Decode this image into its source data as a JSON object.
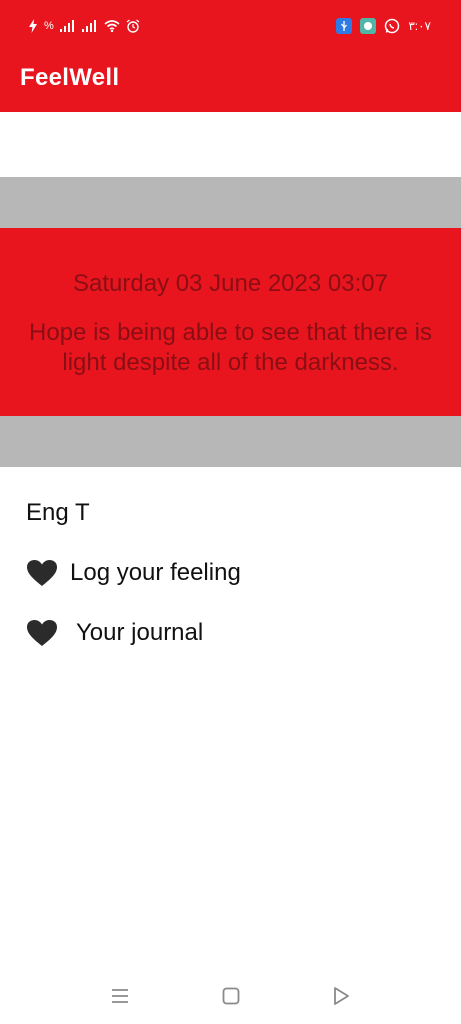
{
  "status_bar": {
    "left_indicators": "%",
    "time": "٣:٠٧",
    "icons": [
      "charging-icon",
      "signal-icon",
      "signal-icon",
      "wifi-icon",
      "alarm-icon",
      "usb-icon",
      "chat-app-icon",
      "whatsapp-icon"
    ]
  },
  "app_bar": {
    "title": "FeelWell"
  },
  "quote_card": {
    "date": "Saturday 03 June 2023 03:07",
    "quote": "Hope is being able to see that there is light despite all of the darkness."
  },
  "menu": {
    "user_name": "Eng T",
    "items": [
      {
        "label": "Log your feeling",
        "icon": "black-heart-icon"
      },
      {
        "label": "Your journal",
        "icon": "black-heart-icon"
      }
    ]
  },
  "colors": {
    "primary_red": "#e8151f",
    "band_gray": "#b8b7b8",
    "quote_text": "#8a0f14"
  },
  "nav_bar": {
    "icons": [
      "recents-icon",
      "home-icon",
      "back-icon"
    ]
  }
}
